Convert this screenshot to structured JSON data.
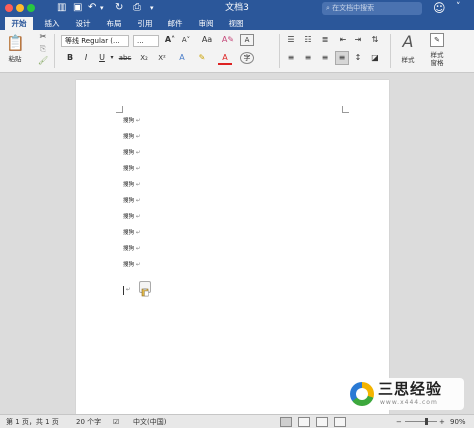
{
  "window": {
    "title": "文档3",
    "search_placeholder": "在文档中搜索",
    "traffic_colors": [
      "#ff5f57",
      "#febc2e",
      "#28c840"
    ]
  },
  "tabs": [
    {
      "label": "开始",
      "active": true
    },
    {
      "label": "插入"
    },
    {
      "label": "设计"
    },
    {
      "label": "布局"
    },
    {
      "label": "引用"
    },
    {
      "label": "邮件"
    },
    {
      "label": "审阅"
    },
    {
      "label": "视图"
    }
  ],
  "ribbon": {
    "paste_label": "粘贴",
    "font_name": "等线 Regular (...",
    "font_size": "...",
    "styles_label": "样式",
    "styles_pane_label": "样式\n窗格"
  },
  "document": {
    "lines": [
      "搜狗",
      "搜狗",
      "搜狗",
      "搜狗",
      "搜狗",
      "搜狗",
      "搜狗",
      "搜狗",
      "搜狗",
      "搜狗"
    ],
    "line_mark": "↵",
    "end_mark": "↵"
  },
  "status": {
    "page": "第 1 页，共 1 页",
    "words": "20 个字",
    "language": "中文(中国)",
    "zoom": "90%"
  },
  "watermark": {
    "title": "三思经验",
    "url": "www.x444.com"
  },
  "colors": {
    "brand": "#2b579a",
    "ribbon_bg": "#f3f3f3"
  }
}
